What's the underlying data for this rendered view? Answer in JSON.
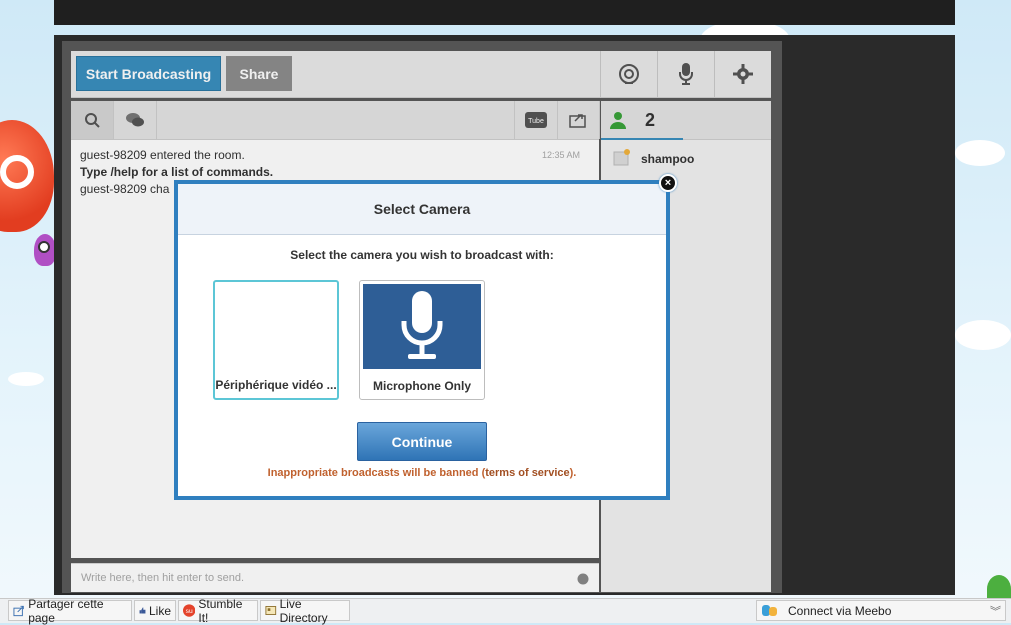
{
  "toolbar": {
    "start_broadcasting": "Start Broadcasting",
    "share": "Share"
  },
  "user_panel": {
    "count": "2",
    "users": [
      {
        "name": "shampoo"
      }
    ]
  },
  "chat": {
    "messages": [
      {
        "text": "guest-98209 entered the room.",
        "time": "12:35 AM",
        "bold": false
      },
      {
        "text": "Type /help for a list of commands.",
        "bold": true
      },
      {
        "text": "guest-98209 cha",
        "bold": false
      }
    ],
    "input_placeholder": "Write here, then hit enter to send."
  },
  "modal": {
    "title": "Select Camera",
    "prompt": "Select the camera you wish to broadcast with:",
    "options": [
      {
        "label": "Périphérique vidéo ...",
        "selected": true
      },
      {
        "label": "Microphone Only",
        "selected": false
      }
    ],
    "continue_label": "Continue",
    "warning_prefix": "Inappropriate broadcasts will be banned (",
    "warning_link": "terms of service",
    "warning_suffix": ")."
  },
  "bottom_bar": {
    "share_page": "Partager cette page",
    "like": "Like",
    "stumble": "Stumble It!",
    "live_directory": "Live Directory",
    "meebo": "Connect via Meebo"
  },
  "colors": {
    "accent": "#3a8fbf",
    "modal_border": "#2f7fbf",
    "warning": "#c0612e",
    "mic_bg": "#2e5e96"
  }
}
